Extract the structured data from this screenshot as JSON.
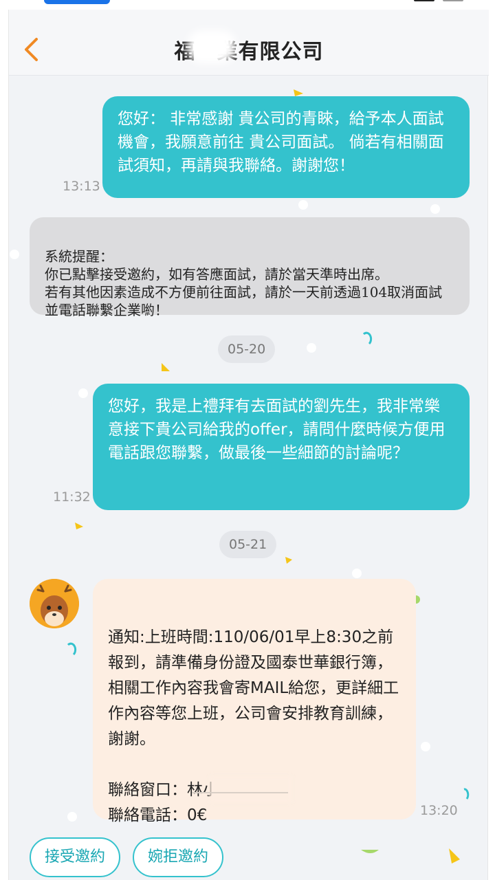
{
  "header": {
    "title_visible": "福　業有限公司",
    "back_icon": "chevron-left-icon"
  },
  "messages": [
    {
      "type": "sent",
      "text": "您好：  非常感謝  貴公司的青睞，給予本人面試機會，我願意前往 貴公司面試。  倘若有相關面試須知，再請與我聯絡。謝謝您！",
      "time": "13:13"
    },
    {
      "type": "system",
      "text": "系統提醒：\n你已點擊接受邀約，如有答應面試，請於當天準時出席。\n若有其他因素造成不方便前往面試，請於一天前透過104取消面試並電話聯繫企業喲！"
    },
    {
      "type": "date",
      "text": "05-20"
    },
    {
      "type": "sent",
      "text": "您好，我是上禮拜有去面試的劉先生，我非常樂意接下貴公司給我的offer，請問什麼時候方便用電話跟您聯繫，做最後一些細節的討論呢？",
      "time": "11:32"
    },
    {
      "type": "date",
      "text": "05-21"
    },
    {
      "type": "received",
      "text": "通知:上班時間:110/06/01早上8:30之前報到，請準備身份證及國泰世華銀行簿，相關工作內容我會寄MAIL給您，更詳細工作內容等您上班，公司會安排教育訓練，謝謝。\n\n聯絡窗口：林小姐\n聯絡電話：0€",
      "time": "13:20"
    }
  ],
  "actions": {
    "accept_label": "接受邀約",
    "decline_label": "婉拒邀約"
  },
  "colors": {
    "accent": "#34c2cd",
    "back_arrow": "#f08a24",
    "received_bubble": "#fdeee2",
    "system_bubble": "#dcdcde",
    "background": "#f1f3f6"
  }
}
